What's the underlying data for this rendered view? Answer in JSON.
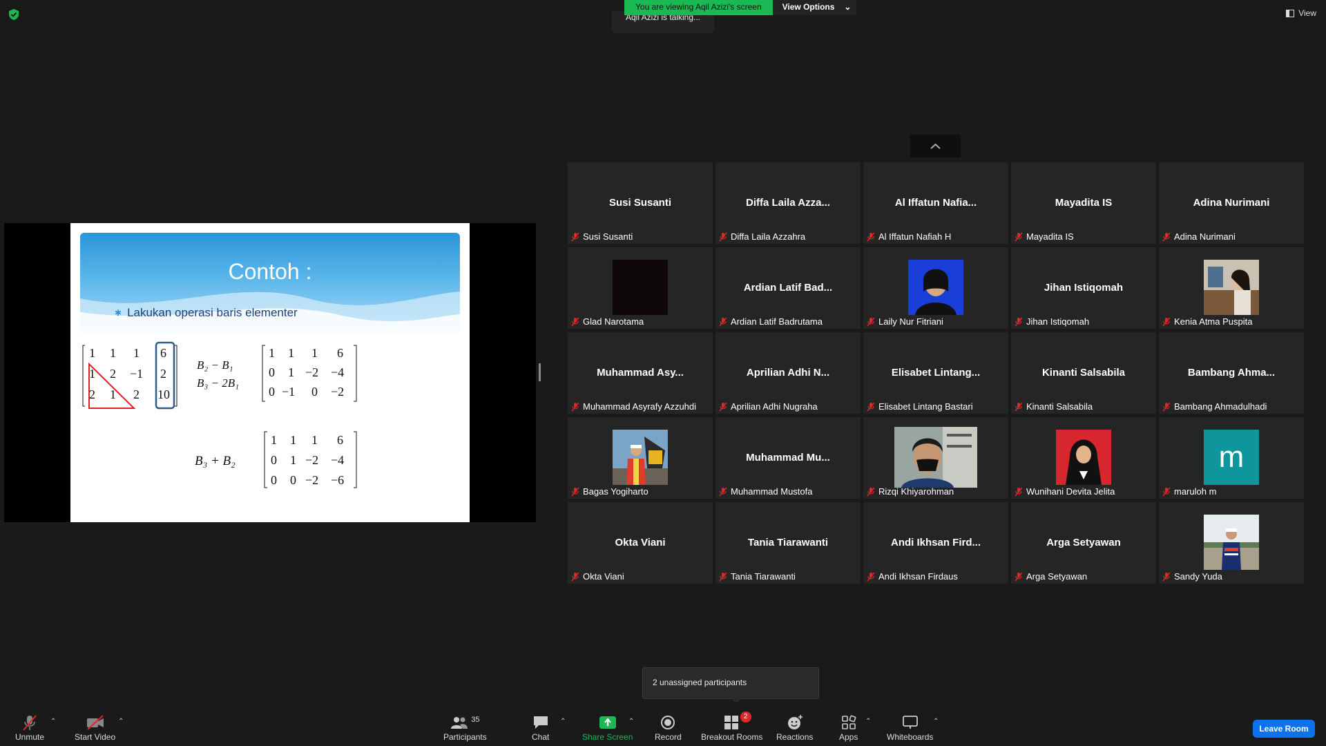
{
  "banner": {
    "viewing": "You are viewing Aqil Azizi's screen",
    "options": "View Options"
  },
  "talking": "Aqil Azizi is talking...",
  "view_label": "View",
  "slide": {
    "title": "Contoh :",
    "bullet": "Lakukan operasi baris elementer"
  },
  "participants": [
    {
      "name": "Susi Susanti",
      "caption": "Susi Susanti",
      "video": "none"
    },
    {
      "name": "Diffa Laila Azza...",
      "caption": "Diffa Laila Azzahra",
      "video": "none"
    },
    {
      "name": "Al Iffatun Nafia...",
      "caption": "Al Iffatun Nafiah H",
      "video": "none"
    },
    {
      "name": "Mayadita IS",
      "caption": "Mayadita IS",
      "video": "none"
    },
    {
      "name": "Adina Nurimani",
      "caption": "Adina Nurimani",
      "video": "none"
    },
    {
      "name": "",
      "caption": "Glad Narotama",
      "video": "dark"
    },
    {
      "name": "Ardian Latif Bad...",
      "caption": "Ardian Latif Badrutama",
      "video": "none"
    },
    {
      "name": "",
      "caption": "Laily Nur Fitriani",
      "video": "photo-blue"
    },
    {
      "name": "Jihan Istiqomah",
      "caption": "Jihan Istiqomah",
      "video": "none"
    },
    {
      "name": "",
      "caption": "Kenia Atma Puspita",
      "video": "photo-cafe"
    },
    {
      "name": "Muhammad Asy...",
      "caption": "Muhammad Asyrafy Azzuhdi",
      "video": "none"
    },
    {
      "name": "Aprilian Adhi N...",
      "caption": "Aprilian Adhi Nugraha",
      "video": "none"
    },
    {
      "name": "Elisabet Lintang...",
      "caption": "Elisabet Lintang Bastari",
      "video": "none"
    },
    {
      "name": "Kinanti Salsabila",
      "caption": "Kinanti Salsabila",
      "video": "none"
    },
    {
      "name": "Bambang Ahma...",
      "caption": "Bambang Ahmadulhadi",
      "video": "none"
    },
    {
      "name": "",
      "caption": "Bagas Yogiharto",
      "video": "photo-excavator"
    },
    {
      "name": "Muhammad Mu...",
      "caption": "Muhammad Mustofa",
      "video": "none"
    },
    {
      "name": "",
      "caption": "Rizqi Khiyarohman",
      "video": "photo-mask"
    },
    {
      "name": "",
      "caption": "Wunihani Devita Jelita",
      "video": "photo-red"
    },
    {
      "name": "",
      "caption": "maruloh m",
      "video": "avatar-m"
    },
    {
      "name": "Okta Viani",
      "caption": "Okta Viani",
      "video": "none"
    },
    {
      "name": "Tania Tiarawanti",
      "caption": "Tania Tiarawanti",
      "video": "none"
    },
    {
      "name": "Andi Ikhsan Fird...",
      "caption": "Andi Ikhsan Firdaus",
      "video": "none"
    },
    {
      "name": "Arga Setyawan",
      "caption": "Arga Setyawan",
      "video": "none"
    },
    {
      "name": "",
      "caption": "Sandy Yuda",
      "video": "photo-outdoor"
    }
  ],
  "avatar_letter": "m",
  "tooltip": "2 unassigned participants",
  "toolbar": {
    "unmute": "Unmute",
    "start_video": "Start Video",
    "participants": "Participants",
    "participants_count": "35",
    "chat": "Chat",
    "share_screen": "Share Screen",
    "record": "Record",
    "breakout_rooms": "Breakout Rooms",
    "breakout_badge": "2",
    "reactions": "Reactions",
    "apps": "Apps",
    "whiteboards": "Whiteboards",
    "leave": "Leave Room"
  },
  "colors": {
    "accent": "#0e72ed",
    "green": "#1bb954",
    "tile": "#252525",
    "mute": "#e02828"
  }
}
